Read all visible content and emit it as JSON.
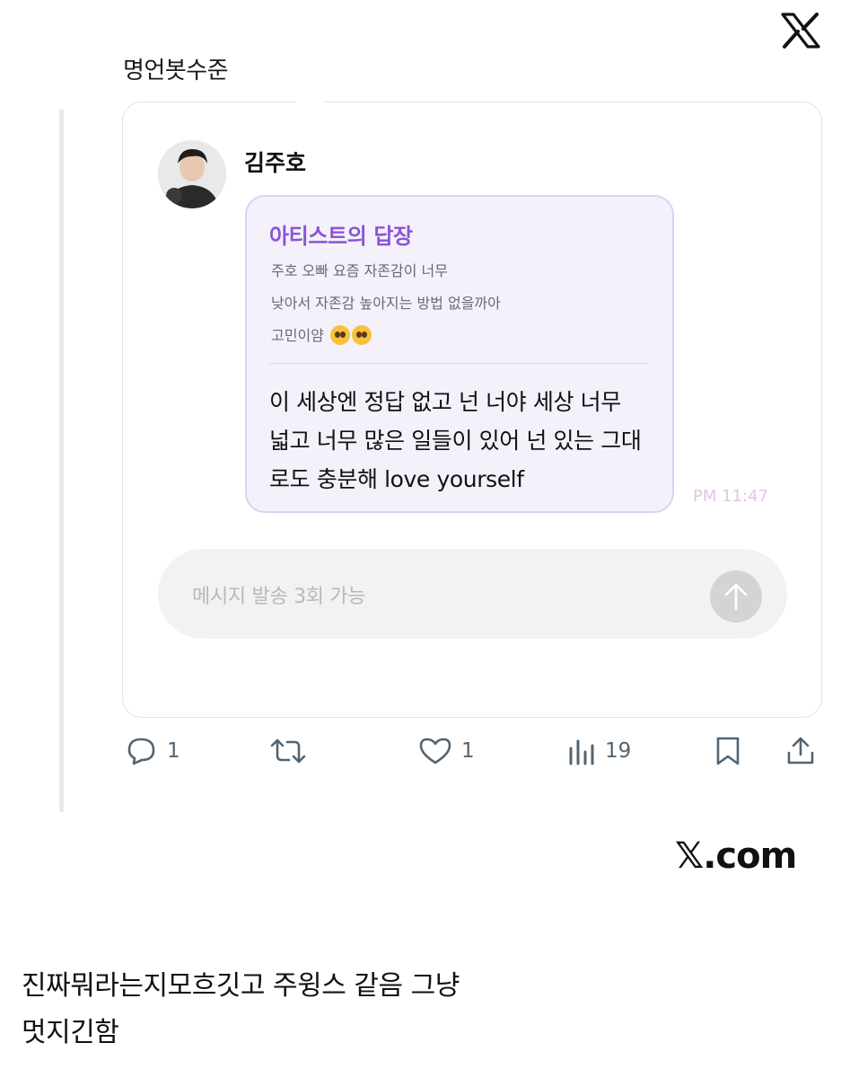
{
  "tweet": {
    "text": "명언봇수준"
  },
  "card": {
    "artist_name": "김주호",
    "bubble_title": "아티스트의 답장",
    "fan_message_lines": [
      "주호 오빠 요즘 자존감이 너무",
      "낮아서 자존감 높아지는 방법 없을까아",
      "고민이얌"
    ],
    "fan_message_emoji": "pleading-face-emoji x2",
    "reply_lines": [
      "이 세상엔 정답 없고 넌 너야 세상 너무",
      "넓고 너무 많은 일들이 있어 넌 있는 그대",
      "로도 충분해 love yourself"
    ],
    "time": "PM 11:47",
    "input_placeholder": "메시지 발송 3회 가능"
  },
  "actions": {
    "reply_count": "1",
    "retweet_count": "",
    "like_count": "1",
    "views_count": "19"
  },
  "watermark": "𝕏.com",
  "caption_lines": [
    "진짜뭐라는지모흐깃고 주윙스 같음 그냥",
    "멋지긴함"
  ],
  "colors": {
    "accent_purple": "#8a54d6",
    "bubble_bg": "#f4f1fb",
    "bubble_border": "#dcd2f3",
    "action_gray": "#536471",
    "time_pink": "#e2c4e6"
  }
}
